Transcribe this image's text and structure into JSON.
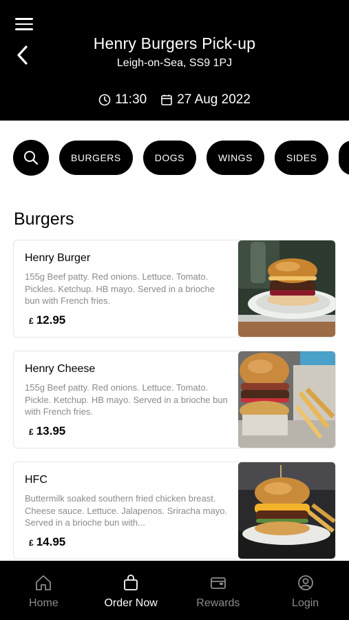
{
  "header": {
    "title": "Henry Burgers Pick-up",
    "subtitle": "Leigh-on-Sea, SS9 1PJ",
    "time": "11:30",
    "date": "27 Aug 2022"
  },
  "categories": [
    "BURGERS",
    "DOGS",
    "WINGS",
    "SIDES"
  ],
  "section": {
    "title": "Burgers"
  },
  "items": [
    {
      "name": "Henry Burger",
      "description": "155g Beef patty. Red onions. Lettuce. Tomato. Pickles. Ketchup. HB mayo. Served in a brioche bun with French fries.",
      "currency": "£",
      "price": "12.95"
    },
    {
      "name": "Henry Cheese",
      "description": "155g Beef patty. Red onions. Lettuce. Tomato. Pickle. Ketchup. HB mayo. Served in a brioche bun with French fries.",
      "currency": "£",
      "price": "13.95"
    },
    {
      "name": "HFC",
      "description": "Buttermilk soaked southern fried chicken breast. Cheese sauce. Lettuce. Jalapenos. Sriracha mayo. Served in a brioche bun with...",
      "currency": "£",
      "price": "14.95"
    }
  ],
  "nav": {
    "items": [
      {
        "label": "Home",
        "icon": "home-icon"
      },
      {
        "label": "Order Now",
        "icon": "bag-icon"
      },
      {
        "label": "Rewards",
        "icon": "wallet-icon"
      },
      {
        "label": "Login",
        "icon": "user-icon"
      }
    ],
    "active": "Order Now"
  },
  "colors": {
    "header_bg": "#000000",
    "chip_bg": "#000000",
    "nav_active": "#ffffff",
    "nav_inactive": "#8c8c8c",
    "description": "#8a8a8a"
  }
}
